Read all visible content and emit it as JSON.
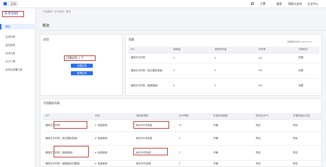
{
  "topbar": {
    "region": "全局",
    "nav": [
      "工单",
      "备案",
      "帮助与支持",
      "企业中心"
    ]
  },
  "sidebar": {
    "title": "文字识别",
    "items": [
      "概览",
      "应用列表",
      "监控报表",
      "技术文档",
      "SDK下载",
      "私有化部署方案"
    ]
  },
  "breadcrumb": "产品服务 / 文字识别 - 概览",
  "page_title": "概览",
  "apps": {
    "heading": "应用",
    "created_label": "已建应用: 1 个",
    "create_button": "创建应用",
    "manage_button": "管理应用"
  },
  "usage": {
    "heading": "用量",
    "date_label": "数据更新时间: 2020-07-01",
    "columns": [
      "API",
      "调用量",
      "调用失败量",
      "失败率",
      "详细统计"
    ],
    "rows": [
      [
        "通用文字识别",
        "0",
        "0",
        "0%",
        "查看"
      ],
      [
        "通用文字识别（含位置信息版）",
        "0",
        "0",
        "0%",
        "查看"
      ],
      [
        "通用文字识别（高精度版）",
        "0",
        "0",
        "0%",
        "查看"
      ]
    ]
  },
  "services": {
    "heading": "可用服务列表",
    "columns": [
      "API",
      "状态",
      "调用量限制",
      "QPS限制",
      "付费购买额度",
      "购买后QPS",
      "开通按量后付费"
    ],
    "rows": [
      [
        "通用文字识别",
        "免费使用",
        "每日500次免费",
        "10",
        "开通",
        "购买",
        "购买"
      ],
      [
        "通用文字识别（含位置信息版）",
        "免费使用",
        "每日500次免费",
        "2",
        "开通",
        "购买",
        "购买"
      ],
      [
        "通用文字识别（高精度版）",
        "免费使用",
        "每日50次免费",
        "2",
        "开通",
        "购买",
        "购买"
      ],
      [
        "通用文字识别（高精度含位置版）",
        "免费使用",
        "每日50次免费",
        "2",
        "开通",
        "购买",
        "购买"
      ]
    ]
  }
}
